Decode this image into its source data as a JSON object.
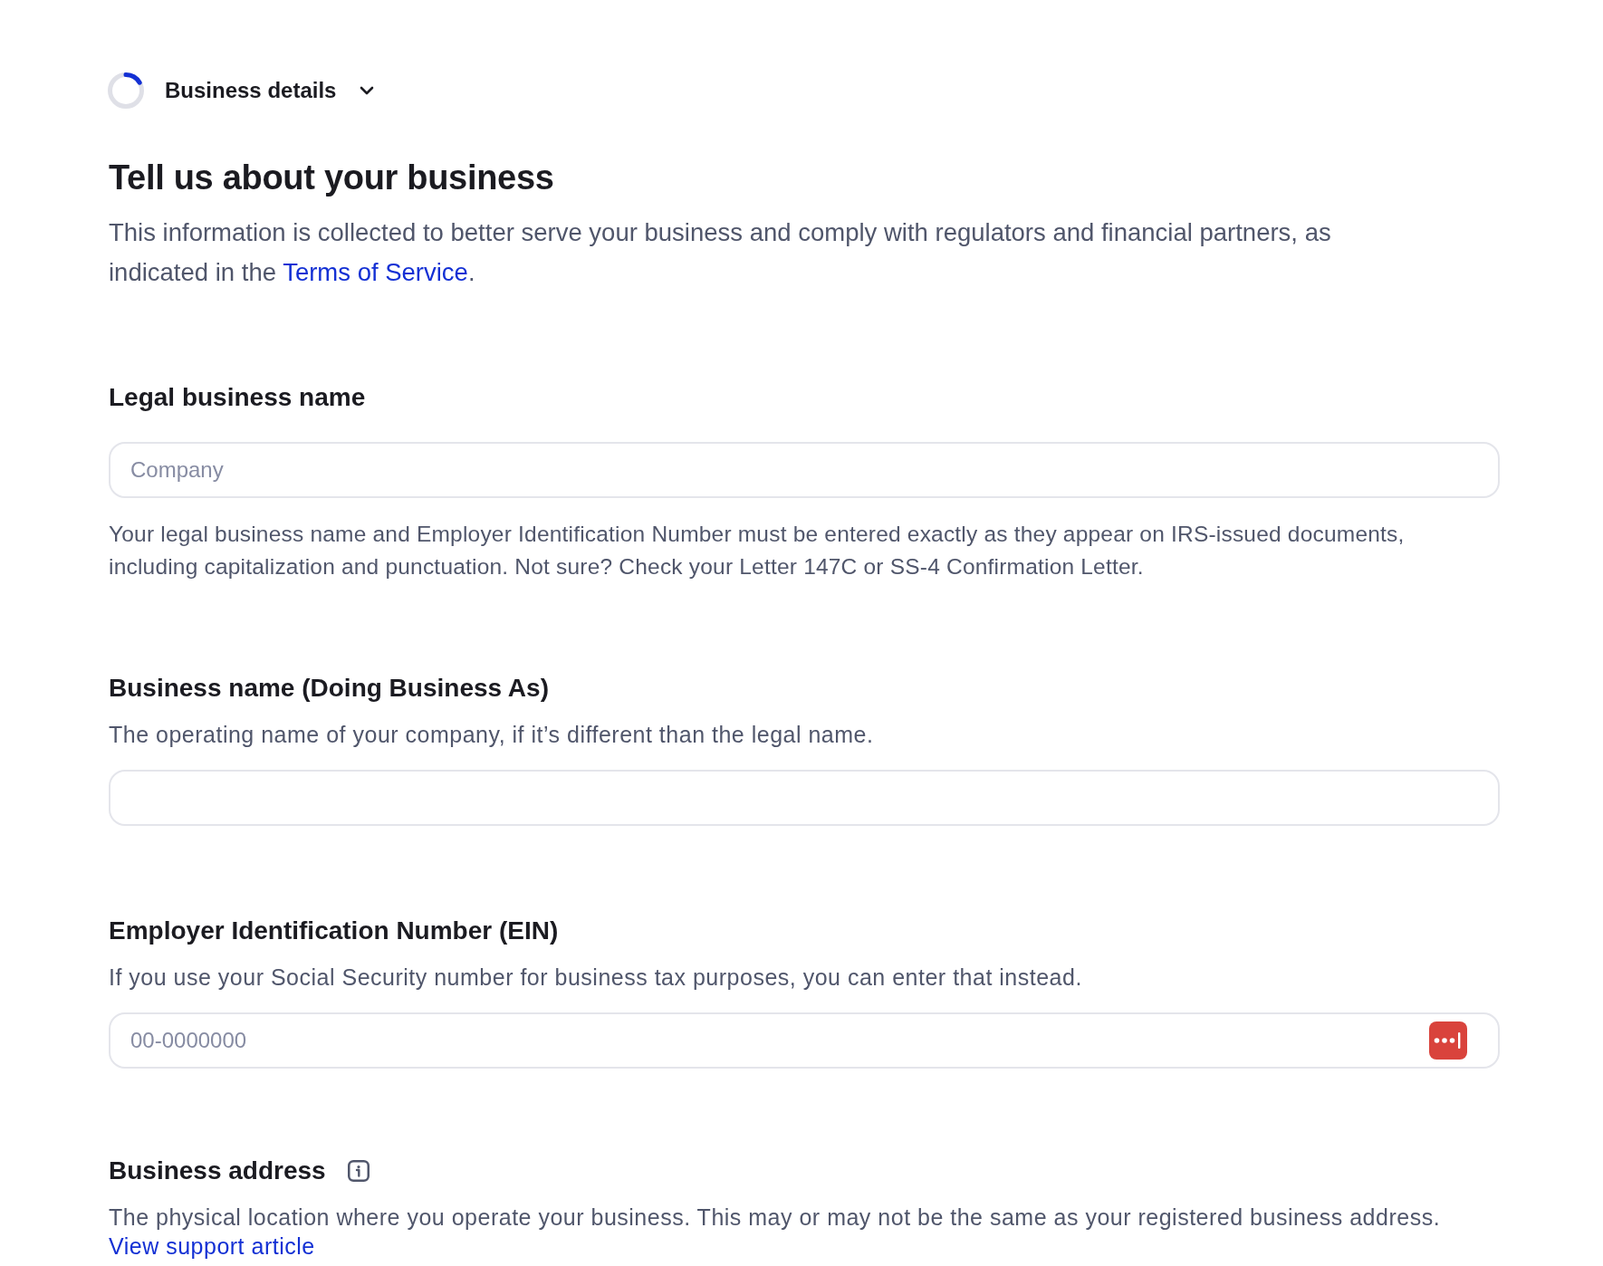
{
  "header": {
    "step_title": "Business details"
  },
  "intro": {
    "title": "Tell us about your business",
    "parts": [
      {
        "kind": "text",
        "text": "This information is collected to better serve your business and comply with regulators and financial partners, as indicated in the "
      },
      {
        "kind": "link",
        "text": "Terms of Service"
      },
      {
        "kind": "text",
        "text": "."
      }
    ]
  },
  "fields": [
    {
      "kind": "input",
      "label": "Legal business name",
      "placeholder": "Company",
      "help": "Your legal business name and Employer Identification Number must be entered exactly as they appear on IRS-issued documents, including capitalization and punctuation. Not sure? Check your Letter 147C or SS-4 Confirmation Letter."
    },
    {
      "kind": "input",
      "label": "Business name (Doing Business As)",
      "description": [
        {
          "kind": "text",
          "text": "The operating name of your company, if it’s different than the legal name."
        }
      ]
    },
    {
      "kind": "autofill",
      "label": "Employer Identification Number (EIN)",
      "description": [
        {
          "kind": "text",
          "text": "If you use your Social Security number for business tax purposes, you can enter that instead."
        }
      ],
      "placeholder": "00-0000000"
    },
    {
      "kind": "info",
      "label": "Business address",
      "description": [
        {
          "kind": "text",
          "text": "The physical location where you operate your business. This may or may not be the same as your registered business address. "
        },
        {
          "kind": "link",
          "text": "View support article"
        }
      ]
    }
  ]
}
